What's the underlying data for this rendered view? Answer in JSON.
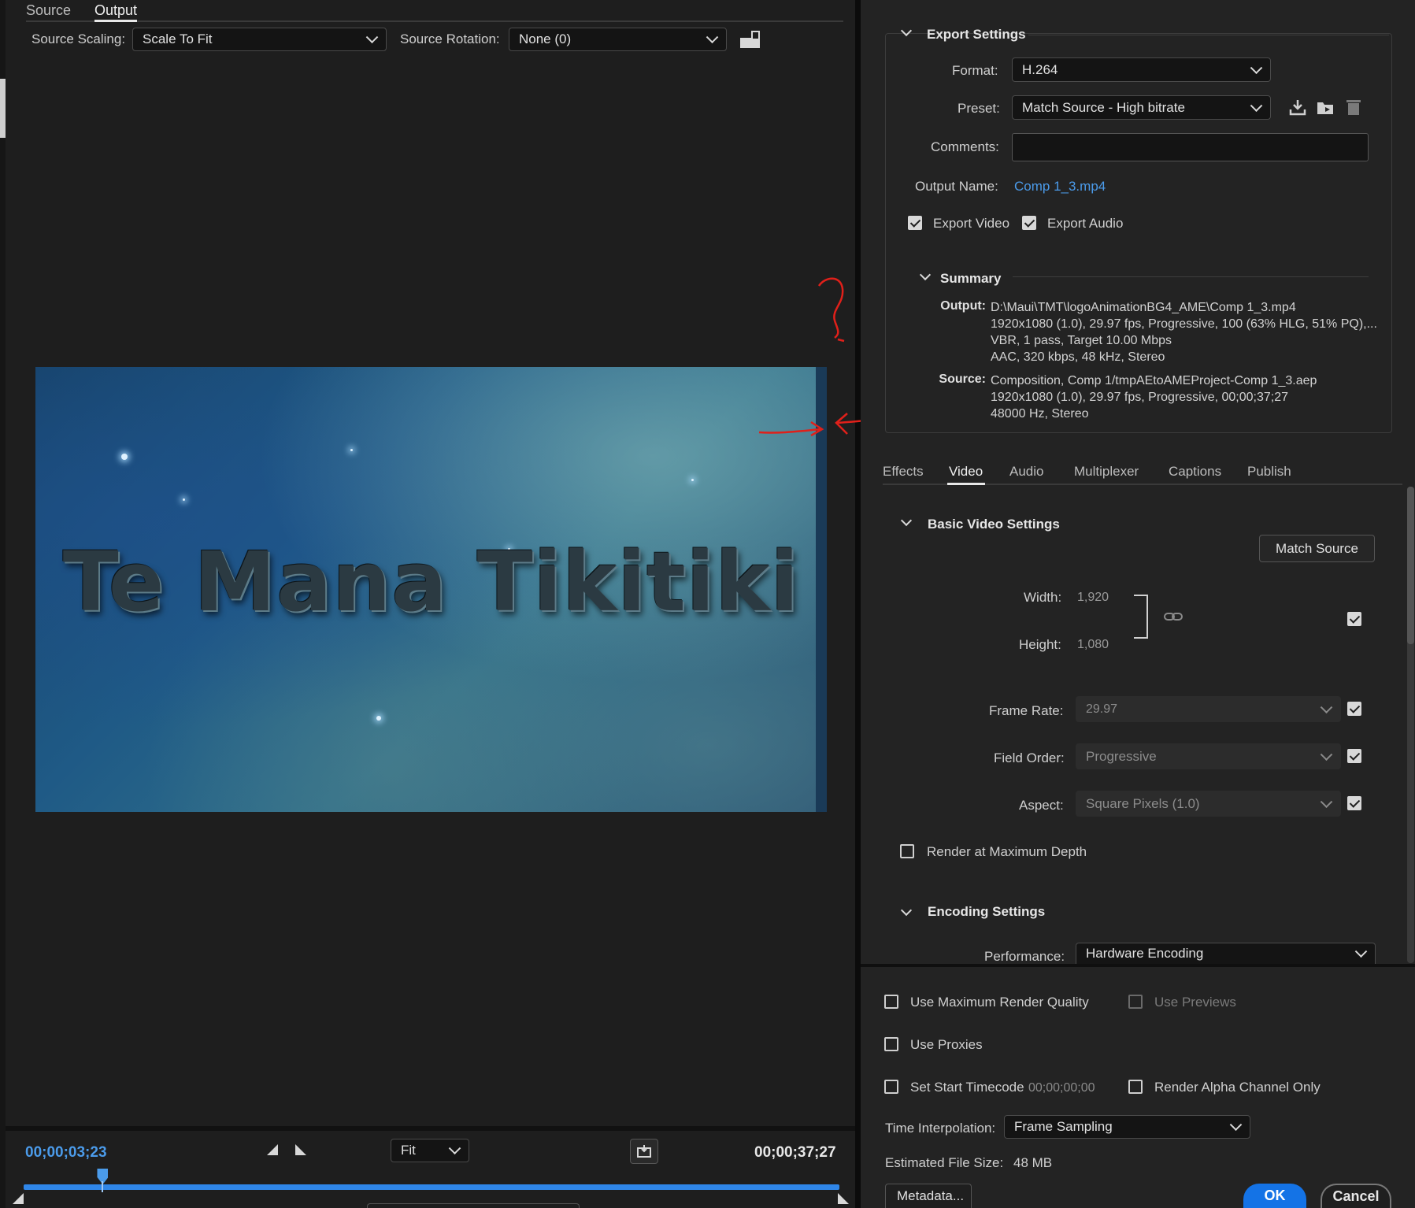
{
  "preview_panel": {
    "tabs": [
      {
        "label": "Source"
      },
      {
        "label": "Output"
      }
    ],
    "source_scaling_label": "Source Scaling:",
    "source_scaling_value": "Scale To Fit",
    "source_rotation_label": "Source Rotation:",
    "source_rotation_value": "None (0)",
    "video_title": "Te Mana Tikitiki",
    "current_timecode": "00;00;03;23",
    "end_timecode": "00;00;37;27",
    "zoom_value": "Fit",
    "playhead_fraction": 0.097
  },
  "export_settings": {
    "header": "Export Settings",
    "format_label": "Format:",
    "format_value": "H.264",
    "preset_label": "Preset:",
    "preset_value": "Match Source - High bitrate",
    "comments_label": "Comments:",
    "comments_value": "",
    "output_name_label": "Output Name:",
    "output_name_value": "Comp 1_3.mp4",
    "export_video_label": "Export Video",
    "export_video_checked": true,
    "export_audio_label": "Export Audio",
    "export_audio_checked": true
  },
  "summary": {
    "header": "Summary",
    "output_key": "Output:",
    "output_lines": [
      "D:\\Maui\\TMT\\logoAnimationBG4_AME\\Comp 1_3.mp4",
      "1920x1080 (1.0), 29.97 fps, Progressive, 100 (63% HLG, 51% PQ),...",
      "VBR, 1 pass, Target 10.00 Mbps",
      "AAC, 320 kbps, 48 kHz, Stereo"
    ],
    "source_key": "Source:",
    "source_lines": [
      "Composition, Comp 1/tmpAEtoAMEProject-Comp 1_3.aep",
      "1920x1080 (1.0), 29.97 fps, Progressive, 00;00;37;27",
      "48000 Hz, Stereo"
    ]
  },
  "settings_tabs": [
    {
      "label": "Effects"
    },
    {
      "label": "Video"
    },
    {
      "label": "Audio"
    },
    {
      "label": "Multiplexer"
    },
    {
      "label": "Captions"
    },
    {
      "label": "Publish"
    }
  ],
  "basic_video": {
    "header": "Basic Video Settings",
    "match_source_label": "Match Source",
    "width_label": "Width:",
    "width_value": "1,920",
    "height_label": "Height:",
    "height_value": "1,080",
    "frame_rate_label": "Frame Rate:",
    "frame_rate_value": "29.97",
    "field_order_label": "Field Order:",
    "field_order_value": "Progressive",
    "aspect_label": "Aspect:",
    "aspect_value": "Square Pixels (1.0)",
    "render_max_depth_label": "Render at Maximum Depth"
  },
  "encoding": {
    "header": "Encoding Settings",
    "performance_label": "Performance:",
    "performance_value": "Hardware Encoding"
  },
  "bottom": {
    "max_render_quality_label": "Use Maximum Render Quality",
    "use_previews_label": "Use Previews",
    "use_proxies_label": "Use Proxies",
    "set_start_timecode_label": "Set Start Timecode",
    "start_timecode_value": "00;00;00;00",
    "render_alpha_label": "Render Alpha Channel Only",
    "time_interp_label": "Time Interpolation:",
    "time_interp_value": "Frame Sampling",
    "est_size_label": "Estimated File Size:",
    "est_size_value": "48 MB",
    "metadata_label": "Metadata...",
    "ok_label": "OK",
    "cancel_label": "Cancel"
  },
  "colors": {
    "accent": "#1473e6",
    "link": "#4b9bea",
    "annotation": "#e0201a"
  }
}
